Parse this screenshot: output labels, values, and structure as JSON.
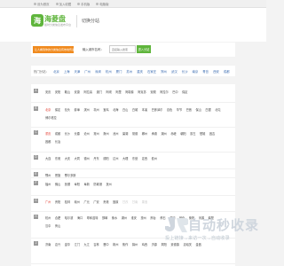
{
  "topbar": {
    "links": [
      "设为首页",
      "加入收藏",
      "手机版",
      "电脑版"
    ]
  },
  "header": {
    "logo_badge": "海",
    "logo_name": "海菱盘",
    "logo_slogan": "随时分类信息发布平台",
    "switch_city": "切换分站"
  },
  "search": {
    "promo": "让人看到你的分类信息有效地传递",
    "label": "输入城市名称：",
    "placeholder": "直接输入搜索",
    "button": "进入分站"
  },
  "hot": {
    "label": "热门分站：",
    "cities": [
      "北京",
      "上海",
      "天津",
      "广州",
      "深圳",
      "杭州",
      "厦门",
      "苏州",
      "重庆",
      "石家庄",
      "郑州",
      "武汉",
      "长沙",
      "南京",
      "青岛",
      "西安",
      "成都"
    ]
  },
  "groups": [
    {
      "letter": "A",
      "cities": [
        {
          "t": "安庆"
        },
        {
          "t": "安阳"
        },
        {
          "t": "鞍山"
        },
        {
          "t": "安康"
        },
        {
          "t": "阿拉善"
        },
        {
          "t": "澳门"
        },
        {
          "t": "阿坝"
        },
        {
          "t": "阿里"
        },
        {
          "t": "阿勒泰"
        },
        {
          "t": "阿克苏"
        },
        {
          "t": "安顺"
        },
        {
          "t": "阿拉尔"
        },
        {
          "t": "巴中"
        },
        {
          "t": "保定"
        }
      ]
    },
    {
      "letter": "B",
      "cities": [
        {
          "t": "北京",
          "c": "red"
        },
        {
          "t": "保定"
        },
        {
          "t": "包头"
        },
        {
          "t": "蚌埠"
        },
        {
          "t": "滨州"
        },
        {
          "t": "亳州"
        },
        {
          "t": "宝鸡"
        },
        {
          "t": "北海"
        },
        {
          "t": "白山"
        },
        {
          "t": "白城"
        },
        {
          "t": "本溪"
        },
        {
          "t": "巴彦淖尔"
        },
        {
          "t": "百色"
        },
        {
          "t": "毕节"
        },
        {
          "t": "巴音"
        },
        {
          "t": "保山"
        },
        {
          "t": "白银"
        },
        {
          "t": "北屯"
        },
        {
          "t": "博尔塔拉"
        }
      ]
    },
    {
      "letter": "C",
      "cities": [
        {
          "t": "重庆",
          "c": "red"
        },
        {
          "t": "成都"
        },
        {
          "t": "长沙"
        },
        {
          "t": "长春"
        },
        {
          "t": "沧州"
        },
        {
          "t": "常州"
        },
        {
          "t": "滁州"
        },
        {
          "t": "池州"
        },
        {
          "t": "巢湖"
        },
        {
          "t": "常德"
        },
        {
          "t": "郴州"
        },
        {
          "t": "承德"
        },
        {
          "t": "潮州"
        },
        {
          "t": "赤峰"
        },
        {
          "t": "朝阳"
        },
        {
          "t": "崇左"
        },
        {
          "t": "楚雄"
        },
        {
          "t": "昌吉"
        },
        {
          "t": "昌都"
        },
        {
          "t": "长治"
        }
      ]
    },
    {
      "letter": "D",
      "cities": [
        {
          "t": "大连"
        },
        {
          "t": "东莞"
        },
        {
          "t": "大庆"
        },
        {
          "t": "大同"
        },
        {
          "t": "德州"
        },
        {
          "t": "丹东"
        },
        {
          "t": "德阳"
        },
        {
          "t": "达州"
        },
        {
          "t": "大理"
        },
        {
          "t": "东营"
        },
        {
          "t": "定西"
        },
        {
          "t": "儋州"
        }
      ]
    },
    {
      "letter": "E",
      "cities": [
        {
          "t": "鄂州"
        },
        {
          "t": "恩施"
        },
        {
          "t": "鄂尔多斯"
        }
      ]
    },
    {
      "letter": "F",
      "cities": [
        {
          "t": "福州"
        },
        {
          "t": "佛山"
        },
        {
          "t": "抚顺"
        },
        {
          "t": "阜阳"
        },
        {
          "t": "阜新"
        },
        {
          "t": "防城港"
        },
        {
          "t": "抚州"
        }
      ]
    },
    {
      "letter": "G",
      "cities": [
        {
          "t": "广州",
          "c": "red"
        },
        {
          "t": "贵阳"
        },
        {
          "t": "桂林"
        },
        {
          "t": "赣州"
        },
        {
          "t": "广元"
        },
        {
          "t": "广安"
        },
        {
          "t": "贵港"
        },
        {
          "t": "固原"
        },
        {
          "t": "甘孜",
          "c": "faded"
        },
        {
          "t": "甘南",
          "c": "faded"
        },
        {
          "t": "果洛",
          "c": "faded"
        }
      ]
    },
    {
      "letter": "H",
      "cities": [
        {
          "t": "杭州"
        },
        {
          "t": "合肥"
        },
        {
          "t": "哈尔滨"
        },
        {
          "t": "海口"
        },
        {
          "t": "呼和浩特"
        },
        {
          "t": "邯郸"
        },
        {
          "t": "衡水"
        },
        {
          "t": "湖州"
        },
        {
          "t": "淮安"
        },
        {
          "t": "惠州"
        },
        {
          "t": "邢台"
        },
        {
          "t": "黄石"
        },
        {
          "t": "黄冈"
        },
        {
          "t": "怀化"
        },
        {
          "t": "衡阳"
        },
        {
          "t": "河源"
        },
        {
          "t": "鹤壁"
        },
        {
          "t": "汉中"
        },
        {
          "t": "黄山"
        }
      ]
    },
    {
      "letter": "J",
      "cities": [
        {
          "t": "济南"
        },
        {
          "t": "嘉兴"
        },
        {
          "t": "金华"
        },
        {
          "t": "江门"
        },
        {
          "t": "九江"
        },
        {
          "t": "吉林"
        },
        {
          "t": "晋中"
        },
        {
          "t": "荆州"
        },
        {
          "t": "焦作"
        },
        {
          "t": "锦州"
        },
        {
          "t": "鸡西"
        },
        {
          "t": "济源"
        },
        {
          "t": "揭阳"
        },
        {
          "t": "景德镇"
        },
        {
          "t": "嘉峪关"
        },
        {
          "t": "金昌"
        }
      ]
    }
  ],
  "watermark": {
    "title": "自动秒收录",
    "subtitle": "投上链接→来访一次→自动收录"
  }
}
